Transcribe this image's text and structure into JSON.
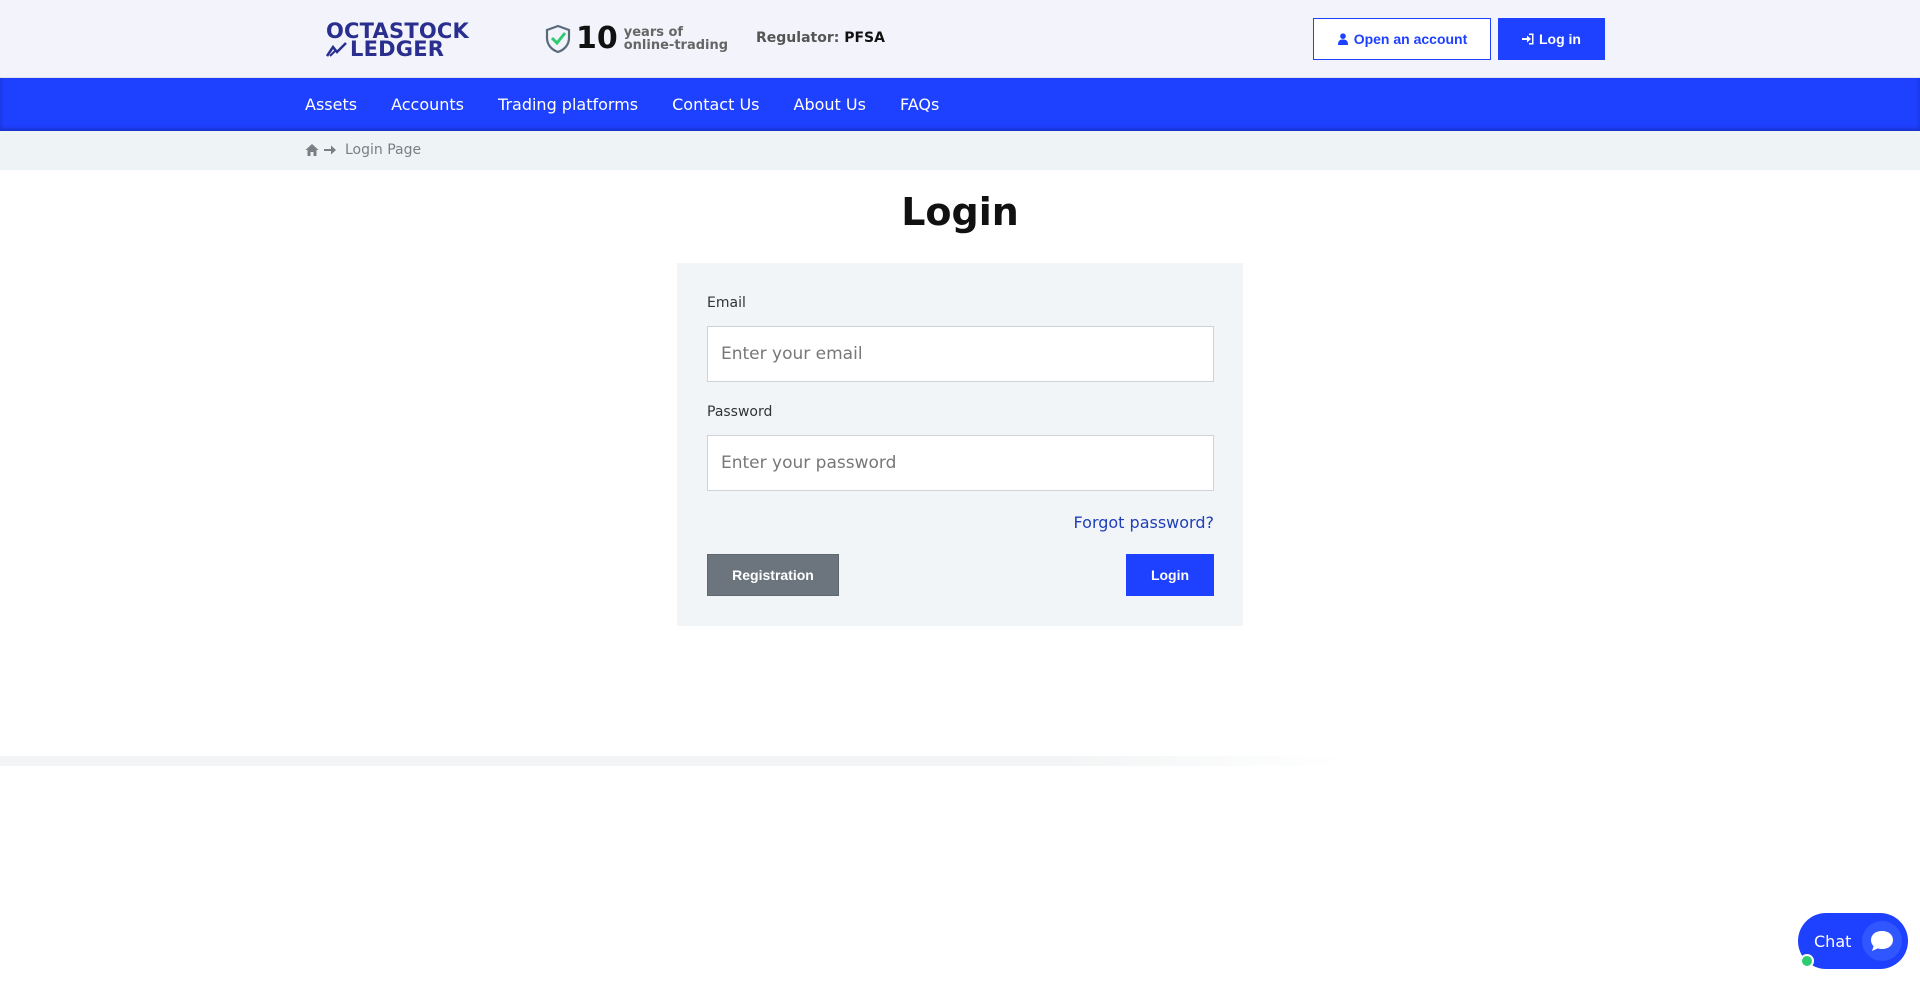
{
  "header": {
    "logo": {
      "line1": "OCTASTOCK",
      "line2": "LEDGER"
    },
    "experience": {
      "number": "10",
      "line1": "years of",
      "line2": "online-trading"
    },
    "regulator": {
      "label": "Regulator:",
      "value": "PFSA"
    },
    "open_account_label": "Open an account",
    "login_label": "Log in"
  },
  "nav": {
    "items": [
      {
        "label": "Assets"
      },
      {
        "label": "Accounts"
      },
      {
        "label": "Trading platforms"
      },
      {
        "label": "Contact Us"
      },
      {
        "label": "About Us"
      },
      {
        "label": "FAQs"
      }
    ]
  },
  "breadcrumb": {
    "current": "Login Page",
    "icons": [
      "home-icon",
      "arrow-right-icon"
    ]
  },
  "main": {
    "title": "Login",
    "email": {
      "label": "Email",
      "placeholder": "Enter your email",
      "value": ""
    },
    "password": {
      "label": "Password",
      "placeholder": "Enter your password",
      "value": ""
    },
    "forgot_label": "Forgot password?",
    "registration_label": "Registration",
    "submit_label": "Login"
  },
  "chat": {
    "label": "Chat",
    "status": "online"
  },
  "colors": {
    "accent": "#1e40ff",
    "header_bg": "#f3f4fb",
    "breadcrumb_bg": "#eef3f5",
    "card_bg": "#f1f5f8",
    "secondary_button": "#6c757d",
    "link": "#1f3eb8",
    "logo": "#2a2f8f",
    "online_dot": "#2ecc71"
  }
}
